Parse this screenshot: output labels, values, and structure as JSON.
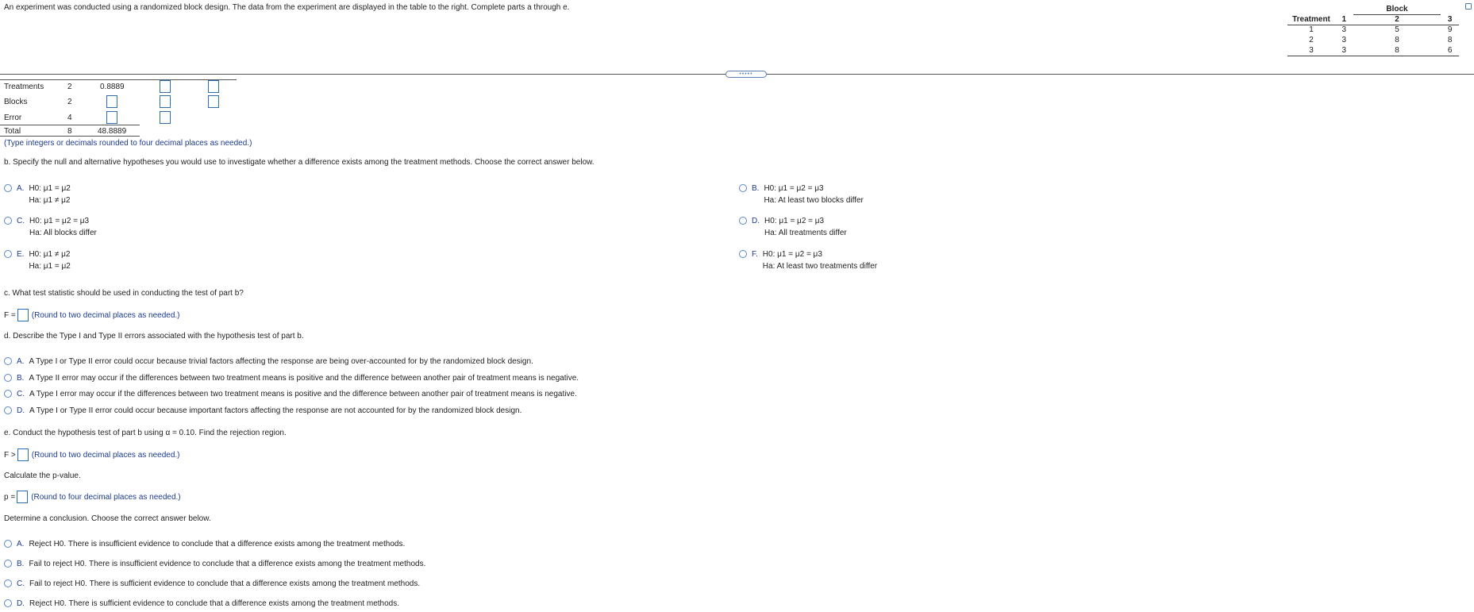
{
  "intro": "An experiment was conducted using a randomized block design. The data from the experiment are displayed in the table to the right. Complete parts a through e.",
  "data_table": {
    "block_header": "Block",
    "treatment_header": "Treatment",
    "block_cols": [
      "1",
      "2",
      "3"
    ],
    "rows": [
      {
        "treatment": "1",
        "values": [
          "3",
          "5",
          "9"
        ]
      },
      {
        "treatment": "2",
        "values": [
          "3",
          "8",
          "8"
        ]
      },
      {
        "treatment": "3",
        "values": [
          "3",
          "8",
          "6"
        ]
      }
    ]
  },
  "divider_handle": "•••••",
  "anova": {
    "rows": [
      {
        "source": "Treatments",
        "df": "2",
        "ss": "0.8889"
      },
      {
        "source": "Blocks",
        "df": "2",
        "ss": ""
      },
      {
        "source": "Error",
        "df": "4",
        "ss": ""
      },
      {
        "source": "Total",
        "df": "8",
        "ss": "48.8889"
      }
    ],
    "hint": "(Type integers or decimals rounded to four decimal places as needed.)"
  },
  "part_b": {
    "question": "b. Specify the null and alternative hypotheses you would use to investigate whether a difference exists among the treatment methods. Choose the correct answer below.",
    "options": [
      {
        "letter": "A.",
        "h0": "H0: μ1 = μ2",
        "ha": "Ha: μ1 ≠ μ2"
      },
      {
        "letter": "B.",
        "h0": "H0: μ1 = μ2 = μ3",
        "ha": "Ha: At least two blocks differ"
      },
      {
        "letter": "C.",
        "h0": "H0: μ1 = μ2 = μ3",
        "ha": "Ha: All blocks differ"
      },
      {
        "letter": "D.",
        "h0": "H0: μ1 = μ2 = μ3",
        "ha": "Ha: All treatments differ"
      },
      {
        "letter": "E.",
        "h0": "H0: μ1 ≠ μ2",
        "ha": "Ha: μ1 = μ2"
      },
      {
        "letter": "F.",
        "h0": "H0: μ1 = μ2 = μ3",
        "ha": "Ha: At least two treatments differ"
      }
    ]
  },
  "part_c": {
    "question": "c. What test statistic should be used in conducting the test of part b?",
    "prefix": "F =",
    "hint": "(Round to two decimal places as needed.)"
  },
  "part_d": {
    "question": "d. Describe the Type I and Type II errors associated with the hypothesis test of part b.",
    "options": [
      {
        "letter": "A.",
        "text": "A Type I or Type II error could occur because trivial factors affecting the response are being over-accounted for by the randomized block design."
      },
      {
        "letter": "B.",
        "text": "A Type II error may occur if the differences between two treatment means is positive and the difference between another pair of treatment means is negative."
      },
      {
        "letter": "C.",
        "text": "A Type I error may occur if the differences between two treatment means is positive and the difference between another pair of treatment means is negative."
      },
      {
        "letter": "D.",
        "text": "A Type I or Type II error could occur because important factors affecting the response are not accounted for by the randomized block design."
      }
    ]
  },
  "part_e": {
    "question": "e. Conduct the hypothesis test of part b using α = 0.10. Find the rejection region.",
    "rr_prefix": "F >",
    "rr_hint": "(Round to two decimal places as needed.)",
    "pvalue_label": "Calculate the p-value.",
    "p_prefix": "p =",
    "p_hint": "(Round to four decimal places as needed.)",
    "conclusion_label": "Determine a conclusion. Choose the correct answer below.",
    "options": [
      {
        "letter": "A.",
        "action": "Reject H0.",
        "text": "There is insufficient evidence to conclude that a difference exists among the treatment methods."
      },
      {
        "letter": "B.",
        "action": "Fail to reject H0.",
        "text": "There is insufficient evidence to conclude that a difference exists among the treatment methods."
      },
      {
        "letter": "C.",
        "action": "Fail to reject H0.",
        "text": "There is sufficient evidence to conclude that a difference exists among the treatment methods."
      },
      {
        "letter": "D.",
        "action": "Reject H0.",
        "text": "There is sufficient evidence to conclude that a difference exists among the treatment methods."
      }
    ]
  }
}
